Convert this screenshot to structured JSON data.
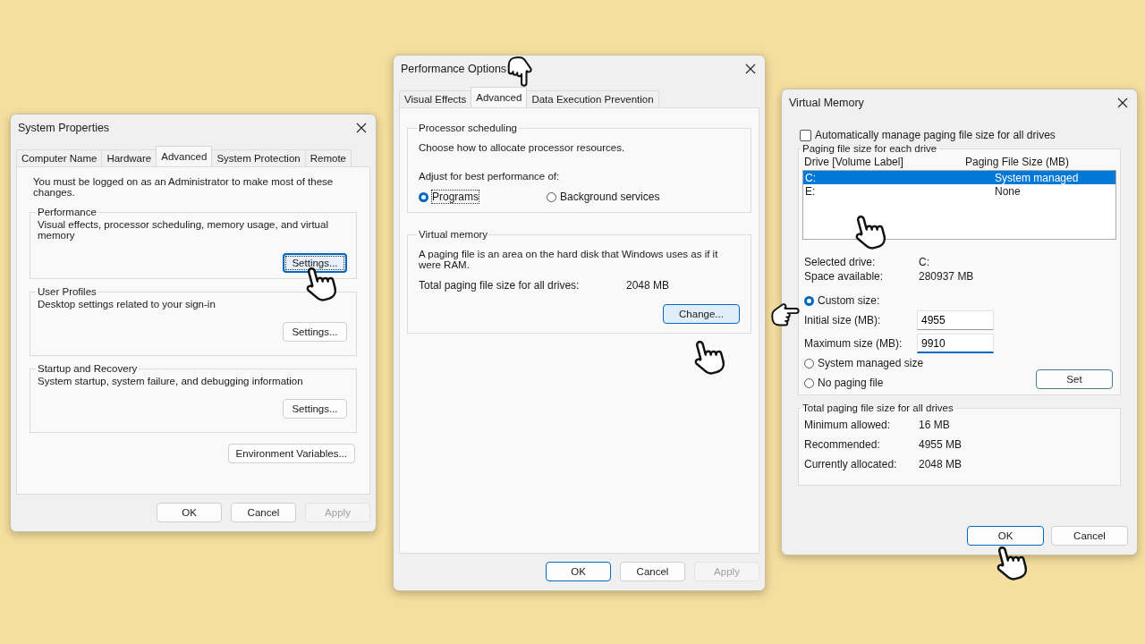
{
  "system_properties": {
    "title": "System Properties",
    "tabs": [
      {
        "label": "Computer Name",
        "selected": false
      },
      {
        "label": "Hardware",
        "selected": false
      },
      {
        "label": "Advanced",
        "selected": true
      },
      {
        "label": "System Protection",
        "selected": false
      },
      {
        "label": "Remote",
        "selected": false
      }
    ],
    "notice": "You must be logged on as an Administrator to make most of these changes.",
    "groups": [
      {
        "title": "Performance",
        "description": "Visual effects, processor scheduling, memory usage, and virtual memory",
        "button": "Settings...",
        "focused": true
      },
      {
        "title": "User Profiles",
        "description": "Desktop settings related to your sign-in",
        "button": "Settings...",
        "focused": false
      },
      {
        "title": "Startup and Recovery",
        "description": "System startup, system failure, and debugging information",
        "button": "Settings...",
        "focused": false
      }
    ],
    "env_button": "Environment Variables...",
    "buttons": [
      {
        "label": "OK",
        "disabled": false
      },
      {
        "label": "Cancel",
        "disabled": false
      },
      {
        "label": "Apply",
        "disabled": true
      }
    ]
  },
  "performance_options": {
    "title": "Performance Options",
    "tabs": [
      {
        "label": "Visual Effects",
        "selected": false
      },
      {
        "label": "Advanced",
        "selected": true
      },
      {
        "label": "Data Execution Prevention",
        "selected": false
      }
    ],
    "scheduling": {
      "title": "Processor scheduling",
      "description": "Choose how to allocate processor resources.",
      "prompt": "Adjust for best performance of:",
      "options": [
        {
          "label": "Programs",
          "selected": true
        },
        {
          "label": "Background services",
          "selected": false
        }
      ]
    },
    "virtual_memory": {
      "title": "Virtual memory",
      "description": "A paging file is an area on the hard disk that Windows uses as if it were RAM.",
      "total_label": "Total paging file size for all drives:",
      "total_value": "2048 MB",
      "button": "Change..."
    },
    "buttons": [
      {
        "label": "OK",
        "disabled": false,
        "default": true
      },
      {
        "label": "Cancel",
        "disabled": false,
        "default": false
      },
      {
        "label": "Apply",
        "disabled": true,
        "default": false
      }
    ]
  },
  "virtual_memory": {
    "title": "Virtual Memory",
    "auto_manage": {
      "label": "Automatically manage paging file size for all drives",
      "checked": false
    },
    "drives_group": "Paging file size for each drive",
    "columns": [
      "Drive  [Volume Label]",
      "Paging File Size (MB)"
    ],
    "drives": [
      {
        "drive": "C:",
        "size": "System managed",
        "selected": true
      },
      {
        "drive": "E:",
        "size": "None",
        "selected": false
      }
    ],
    "info": [
      {
        "label": "Selected drive:",
        "value": "C:"
      },
      {
        "label": "Space available:",
        "value": "280937 MB"
      }
    ],
    "size_options": [
      {
        "label": "Custom size:",
        "selected": true
      },
      {
        "label": "System managed size",
        "selected": false
      },
      {
        "label": "No paging file",
        "selected": false
      }
    ],
    "fields": [
      {
        "label": "Initial size (MB):",
        "value": "4955",
        "focused": false
      },
      {
        "label": "Maximum size (MB):",
        "value": "9910",
        "focused": true
      }
    ],
    "set_button": "Set",
    "totals": {
      "title": "Total paging file size for all drives",
      "rows": [
        {
          "label": "Minimum allowed:",
          "value": "16 MB"
        },
        {
          "label": "Recommended:",
          "value": "4955 MB"
        },
        {
          "label": "Currently allocated:",
          "value": "2048 MB"
        }
      ]
    },
    "buttons": [
      {
        "label": "OK",
        "disabled": false,
        "default": true
      },
      {
        "label": "Cancel",
        "disabled": false,
        "default": false
      }
    ]
  }
}
